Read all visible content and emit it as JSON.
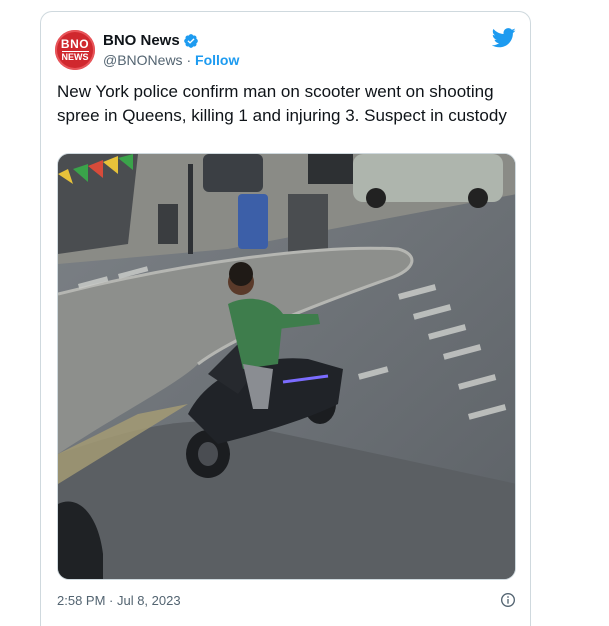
{
  "account": {
    "name": "BNO News",
    "handle": "@BNONews",
    "separator": " · ",
    "follow_label": "Follow",
    "avatar_line1": "BNO",
    "avatar_line2": "NEWS",
    "verified": true
  },
  "tweet": {
    "text": "New York police confirm man on scooter went on shooting spree in Queens, killing 1 and injuring 3. Suspect in custody",
    "timestamp": "2:58 PM · Jul 8, 2023"
  },
  "media": {
    "kind": "cctv-still",
    "description_icon": "photo"
  },
  "icons": {
    "platform": "twitter-bird-icon",
    "verified": "verified-badge-icon",
    "info": "info-icon"
  },
  "colors": {
    "accent": "#1d9bf0",
    "text": "#0f1419",
    "muted": "#536471",
    "avatar": "#d0282e"
  }
}
